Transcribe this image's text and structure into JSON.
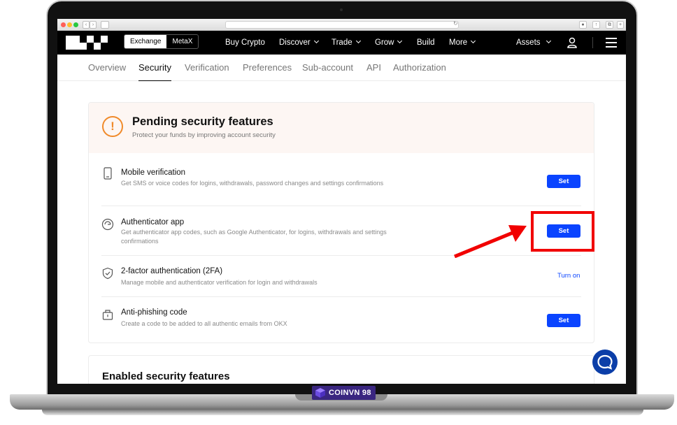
{
  "nav": {
    "segments": [
      "Exchange",
      "MetaX"
    ],
    "links": [
      "Buy Crypto",
      "Discover",
      "Trade",
      "Grow",
      "Build",
      "More"
    ],
    "assets": "Assets"
  },
  "tabs": [
    "Overview",
    "Security",
    "Verification",
    "Preferences",
    "Sub-account",
    "API",
    "Authorization"
  ],
  "active_tab": "Security",
  "pending": {
    "title": "Pending security features",
    "subtitle": "Protect your funds by improving account security",
    "items": [
      {
        "title": "Mobile verification",
        "desc": "Get SMS or voice codes for logins, withdrawals, password changes and settings confirmations",
        "action": "Set",
        "icon": "mobile-icon"
      },
      {
        "title": "Authenticator app",
        "desc": "Get authenticator app codes, such as Google Authenticator, for logins, withdrawals and settings confirmations",
        "action": "Set",
        "icon": "authenticator-icon"
      },
      {
        "title": "2-factor authentication (2FA)",
        "desc": "Manage mobile and authenticator verification for login and withdrawals",
        "action": "Turn on",
        "icon": "shield-icon"
      },
      {
        "title": "Anti-phishing code",
        "desc": "Create a code to be added to all authentic emails from OKX",
        "action": "Set",
        "icon": "anti-phishing-icon"
      }
    ]
  },
  "enabled": {
    "title": "Enabled security features"
  },
  "watermark": "COINVN 98",
  "colors": {
    "accent": "#0a44ff",
    "warning": "#f08a2a",
    "highlight": "#f10000"
  }
}
